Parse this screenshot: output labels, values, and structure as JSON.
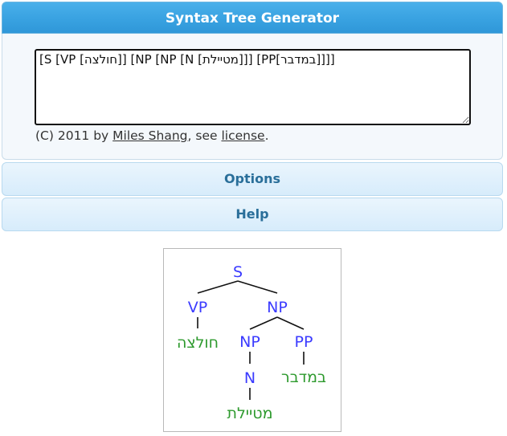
{
  "header": {
    "title": "Syntax Tree Generator"
  },
  "editor": {
    "value": "[S [VP [חולצה]] [NP [NP [N [מטיילת]]] [PP[במדבר]]]]"
  },
  "footer": {
    "prefix": "(C) 2011 by ",
    "author_link": "Miles Shang",
    "middle": ", see ",
    "license_link": "license",
    "suffix": "."
  },
  "sections": {
    "options_label": "Options",
    "help_label": "Help"
  },
  "colors": {
    "nonterminal": "#3b3bff",
    "terminal": "#2e9a2e",
    "header": "#3aa3e2"
  },
  "tree": {
    "labels": {
      "s": "S",
      "vp": "VP",
      "np_top": "NP",
      "np_inner": "NP",
      "pp": "PP",
      "n": "N",
      "leaf_vp": "חולצה",
      "leaf_pp": "במדבר",
      "leaf_n": "מטיילת"
    }
  }
}
